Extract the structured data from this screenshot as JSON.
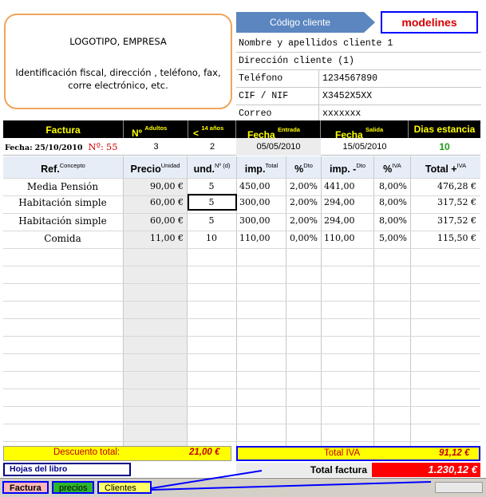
{
  "header": {
    "logo_line1": "LOGOTIPO, EMPRESA",
    "logo_line2": "Identificación fiscal, dirección , teléfono, fax, corre electrónico, etc.",
    "codigo_cliente": "Código cliente",
    "modelines": "modelines"
  },
  "client": {
    "nombre": "Nombre y apellidos cliente 1",
    "direccion": "Dirección cliente (1)",
    "telefono_label": "Teléfono",
    "telefono": "1234567890",
    "cif_label": "CIF / NIF",
    "cif": "X3452X5XX",
    "correo_label": "Correo",
    "correo": "xxxxxxx"
  },
  "hdr": {
    "factura": "Factura",
    "n": "Nº",
    "adultos": "Adultos",
    "menor": "<",
    "menor_sup": "14 años",
    "fecha": "Fecha",
    "entrada": "Entrada",
    "fecha2": "Fecha",
    "salida": "Salida",
    "dias": "Dias estancia"
  },
  "info": {
    "fecha_label": "Fecha:",
    "fecha_value": "25/10/2010",
    "n_label": "Nº:",
    "n_value": "55",
    "adultos": "3",
    "menores": "2",
    "entrada": "05/05/2010",
    "salida": "15/05/2010",
    "dias": "10"
  },
  "columns": {
    "ref": "Ref.",
    "ref_sup": "Concepto",
    "precio": "Precio",
    "precio_sup": "Unidad",
    "und": "und.",
    "und_sup": "Nº (d)",
    "imp": "imp.",
    "imp_sup": "Total",
    "pct_dto": "%",
    "pct_dto_sup": "Dto",
    "imp_dto": "imp. -",
    "imp_dto_sup": "Dto",
    "pct_iva": "%",
    "pct_iva_sup": "IVA",
    "total": "Total +",
    "total_sup": "IVA"
  },
  "rows": [
    {
      "ref": "Media Pensión",
      "precio": "90,00 €",
      "und": "5",
      "imp": "450,00",
      "dto": "2,00%",
      "impdto": "441,00",
      "iva": "8,00%",
      "total": "476,28 €"
    },
    {
      "ref": "Habitación simple",
      "precio": "60,00 €",
      "und": "5",
      "imp": "300,00",
      "dto": "2,00%",
      "impdto": "294,00",
      "iva": "8,00%",
      "total": "317,52 €"
    },
    {
      "ref": "Habitación simple",
      "precio": "60,00 €",
      "und": "5",
      "imp": "300,00",
      "dto": "2,00%",
      "impdto": "294,00",
      "iva": "8,00%",
      "total": "317,52 €"
    },
    {
      "ref": "Comida",
      "precio": "11,00 €",
      "und": "10",
      "imp": "110,00",
      "dto": "0,00%",
      "impdto": "110,00",
      "iva": "5,00%",
      "total": "115,50 €"
    }
  ],
  "footer": {
    "descuento_label": "Descuento total:",
    "descuento_value": "21,00 €",
    "total_iva_label": "Total IVA",
    "total_iva_value": "91,12 €",
    "hojas": "Hojas del libro",
    "total_factura_label": "Total factura",
    "total_factura_value": "1.230,12 €"
  },
  "tabs": [
    "Factura",
    "precios",
    "Clientes"
  ],
  "colors": {
    "accent": "#5b86c0",
    "header_bg": "#000000",
    "header_text": "#ffff00",
    "highlight": "#ffff00",
    "total_red": "#ff0000",
    "link_blue": "#0000ff"
  }
}
